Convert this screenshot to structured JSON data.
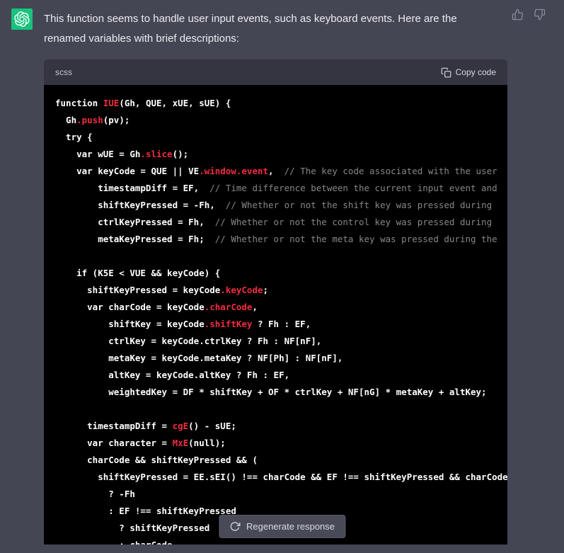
{
  "theme": {
    "page_bg": "#444654",
    "code_bg": "#000000",
    "code_header_bg": "#343541",
    "avatar_bg": "#19c37d",
    "token_red": "#f22c3d",
    "comment_gray": "rgba(255,255,255,0.52)",
    "text_color": "#ececf1"
  },
  "icons": {
    "avatar": "openai-logo-icon",
    "like": "thumbs-up-icon",
    "dislike": "thumbs-down-icon",
    "copy": "clipboard-icon",
    "regenerate": "refresh-icon"
  },
  "message": {
    "lines": [
      "This function seems to handle user input events, such as keyboard events. Here are the",
      "renamed variables with brief descriptions:"
    ]
  },
  "code_block": {
    "language": "scss",
    "copy_label": "Copy code",
    "lines": [
      [
        {
          "c": "p",
          "t": "function "
        },
        {
          "c": "r",
          "t": "IUE"
        },
        {
          "c": "p",
          "t": "(Gh, QUE, xUE, sUE) {"
        }
      ],
      [
        {
          "c": "p",
          "t": "  Gh"
        },
        {
          "c": "r",
          "t": ".push"
        },
        {
          "c": "p",
          "t": "(pv);"
        }
      ],
      [
        {
          "c": "p",
          "t": "  try {"
        }
      ],
      [
        {
          "c": "p",
          "t": "    var wUE = Gh"
        },
        {
          "c": "r",
          "t": ".slice"
        },
        {
          "c": "p",
          "t": "();"
        }
      ],
      [
        {
          "c": "p",
          "t": "    var keyCode = QUE || VE"
        },
        {
          "c": "r",
          "t": ".window.event"
        },
        {
          "c": "p",
          "t": ","
        },
        {
          "c": "c",
          "t": "  // The key code associated with the user"
        }
      ],
      [
        {
          "c": "p",
          "t": "        timestampDiff = EF,"
        },
        {
          "c": "c",
          "t": "  // Time difference between the current input event and"
        }
      ],
      [
        {
          "c": "p",
          "t": "        shiftKeyPressed = -Fh,"
        },
        {
          "c": "c",
          "t": "  // Whether or not the shift key was pressed during"
        }
      ],
      [
        {
          "c": "p",
          "t": "        ctrlKeyPressed = Fh,"
        },
        {
          "c": "c",
          "t": "  // Whether or not the control key was pressed during"
        }
      ],
      [
        {
          "c": "p",
          "t": "        metaKeyPressed = Fh;"
        },
        {
          "c": "c",
          "t": "  // Whether or not the meta key was pressed during the"
        }
      ],
      [],
      [
        {
          "c": "p",
          "t": "    if (K5E < VUE && keyCode) {"
        }
      ],
      [
        {
          "c": "p",
          "t": "      shiftKeyPressed = keyCode"
        },
        {
          "c": "r",
          "t": ".keyCode"
        },
        {
          "c": "p",
          "t": ";"
        }
      ],
      [
        {
          "c": "p",
          "t": "      var charCode = keyCode"
        },
        {
          "c": "r",
          "t": ".charCode"
        },
        {
          "c": "p",
          "t": ","
        }
      ],
      [
        {
          "c": "p",
          "t": "          shiftKey = keyCode"
        },
        {
          "c": "r",
          "t": ".shiftKey"
        },
        {
          "c": "p",
          "t": " ? Fh : EF,"
        }
      ],
      [
        {
          "c": "p",
          "t": "          ctrlKey = keyCode.ctrlKey ? Fh : NF[nF],"
        }
      ],
      [
        {
          "c": "p",
          "t": "          metaKey = keyCode.metaKey ? NF[Ph] : NF[nF],"
        }
      ],
      [
        {
          "c": "p",
          "t": "          altKey = keyCode.altKey ? Fh : EF,"
        }
      ],
      [
        {
          "c": "p",
          "t": "          weightedKey = DF * shiftKey + OF * ctrlKey + NF[nG] * metaKey + altKey;"
        }
      ],
      [],
      [
        {
          "c": "p",
          "t": "      timestampDiff = "
        },
        {
          "c": "r",
          "t": "cgE"
        },
        {
          "c": "p",
          "t": "() - sUE;"
        }
      ],
      [
        {
          "c": "p",
          "t": "      var character = "
        },
        {
          "c": "r",
          "t": "MxE"
        },
        {
          "c": "p",
          "t": "(null);"
        }
      ],
      [
        {
          "c": "p",
          "t": "      charCode && shiftKeyPressed && ("
        }
      ],
      [
        {
          "c": "p",
          "t": "        shiftKeyPressed = EE.sEI() !== charCode && EF !== shiftKeyPressed && charCode"
        }
      ],
      [
        {
          "c": "p",
          "t": "          ? -Fh"
        }
      ],
      [
        {
          "c": "p",
          "t": "          : EF !== shiftKeyPressed"
        }
      ],
      [
        {
          "c": "p",
          "t": "            ? shiftKeyPressed"
        }
      ],
      [
        {
          "c": "p",
          "t": "            : charCode"
        }
      ]
    ]
  },
  "regenerate": {
    "label": "Regenerate response"
  }
}
